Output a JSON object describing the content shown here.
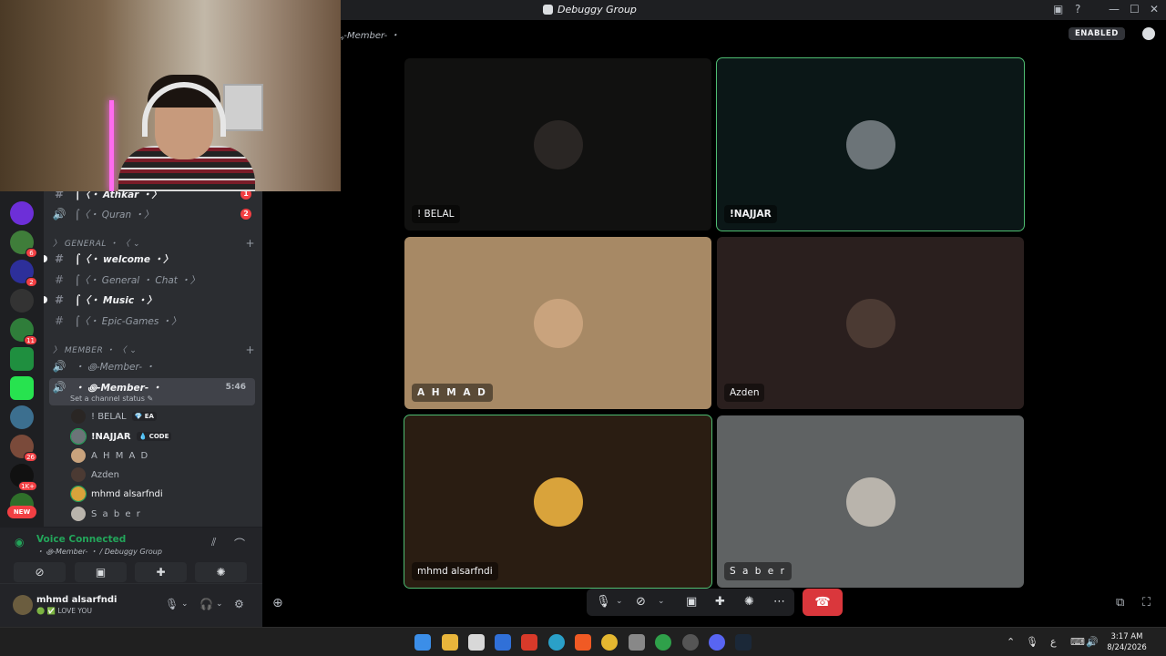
{
  "window": {
    "title": "Debuggy Group",
    "enabled_label": "ENABLED"
  },
  "channel_header": "ﮩ-Member- ・",
  "sidebar": {
    "channels": [
      {
        "symbol": "#",
        "label": "⌠〈・ Athkar ・〉",
        "badge": "1"
      },
      {
        "symbol": "🔊",
        "label": "⌠〈・ Quran ・〉",
        "badge": "2"
      },
      {
        "symbol": "#",
        "label": "⌠〈・ welcome ・〉"
      },
      {
        "symbol": "#",
        "label": "⌠〈・ General ・ Chat ・〉"
      },
      {
        "symbol": "#",
        "label": "⌠〈・ Music ・〉"
      },
      {
        "symbol": "#",
        "label": "⌠〈・ Epic-Games ・〉"
      },
      {
        "symbol": "🔊",
        "label": "・ ꩜-Member- ・"
      },
      {
        "symbol": "🔊",
        "label": "・ ꩜-Member- ・",
        "time": "5:46",
        "status": "Set a channel status ✎"
      }
    ],
    "categories": [
      {
        "label": "〉 GENERAL ・ 〈 ⌄"
      },
      {
        "label": "〉 MEMBER ・ 〈 ⌄"
      }
    ],
    "members": [
      {
        "name": "! BELAL",
        "tag": "💎 EA"
      },
      {
        "name": "!NAJJAR",
        "tag": "💧 CODE"
      },
      {
        "name": "A H M A D"
      },
      {
        "name": "Azden"
      },
      {
        "name": "mhmd alsarfndi"
      },
      {
        "name": "S a b e r"
      }
    ],
    "server_badges": [
      "6",
      "2",
      "11",
      "26",
      "1K+"
    ],
    "new_label": "NEW"
  },
  "voice": {
    "title": "Voice Connected",
    "subtitle": "・ ꩜-Member- ・ / Debuggy Group"
  },
  "user": {
    "name": "mhmd alsarfndi",
    "status": "🟢 ✅ LOVE YOU"
  },
  "tiles": [
    {
      "name": "! BELAL",
      "bg": "#111110",
      "av": "#2a2624"
    },
    {
      "name": "!NAJJAR",
      "bg": "#0b1717",
      "av": "#6c7478"
    },
    {
      "name": "A H M A D",
      "bg": "#a78965",
      "av": "#c9a37d"
    },
    {
      "name": "Azden",
      "bg": "#2a1f1e",
      "av": "#4b3a33"
    },
    {
      "name": "mhmd alsarfndi",
      "bg": "#2a1d12",
      "av": "#d9a33b"
    },
    {
      "name": "S a b e r",
      "bg": "#5f6263",
      "av": "#b9b4ac"
    }
  ],
  "taskbar": {
    "time": "3:17 AM",
    "date": "8/24/2026",
    "lang": "ع"
  },
  "colors": {
    "speaking": "#4fbd72",
    "voice_green": "#23a55a",
    "hangup": "#da373c",
    "badge": "#f23f43"
  }
}
